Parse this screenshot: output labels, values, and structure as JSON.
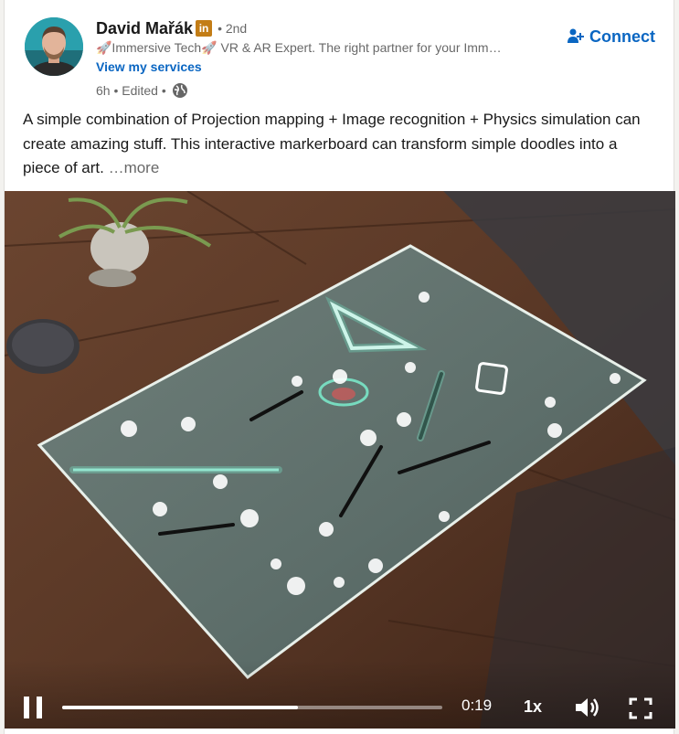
{
  "author": {
    "name": "David Mařák",
    "badge": "in",
    "degree": "• 2nd",
    "headline": "🚀Immersive Tech🚀 VR & AR Expert. The right partner for your Imm…",
    "services_link": "View my services",
    "time": "6h • Edited •",
    "visibility_icon": "globe-icon",
    "avatar_icon": "profile-photo"
  },
  "connect": {
    "label": "Connect",
    "icon": "add-person-icon"
  },
  "post": {
    "text": "A simple combination of Projection mapping + Image recognition + Physics simulation can create amazing stuff. This interactive markerboard can transform simple doodles into a piece of art. ",
    "more": "…more"
  },
  "video": {
    "time": "0:19",
    "speed": "1x",
    "progress": 0.62,
    "pause_icon": "pause-icon",
    "volume_icon": "volume-icon",
    "fullscreen_icon": "fullscreen-icon"
  },
  "colors": {
    "brand_blue": "#0a66c2",
    "badge_gold": "#c37d16",
    "wood": "#5a3826"
  }
}
